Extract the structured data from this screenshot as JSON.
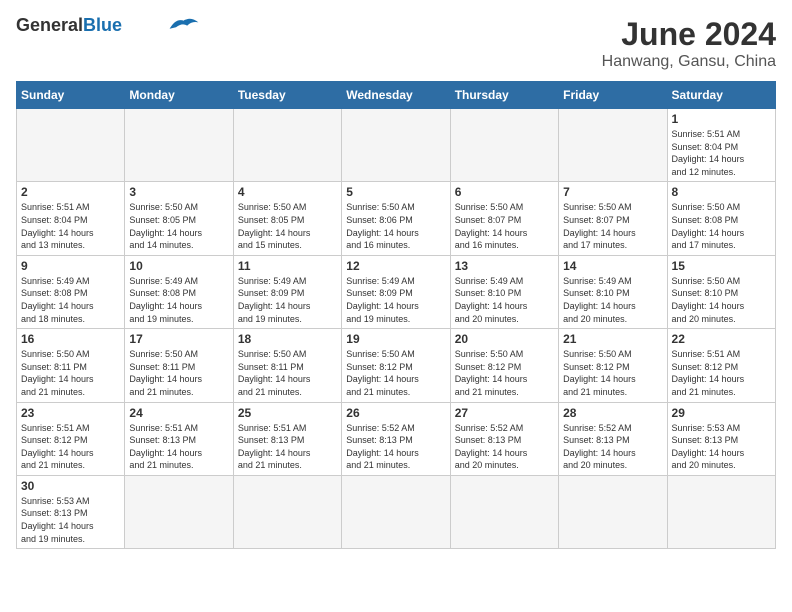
{
  "header": {
    "logo_line1": "General",
    "logo_line2": "Blue",
    "month_title": "June 2024",
    "location": "Hanwang, Gansu, China"
  },
  "weekdays": [
    "Sunday",
    "Monday",
    "Tuesday",
    "Wednesday",
    "Thursday",
    "Friday",
    "Saturday"
  ],
  "weeks": [
    [
      {
        "day": "",
        "info": ""
      },
      {
        "day": "",
        "info": ""
      },
      {
        "day": "",
        "info": ""
      },
      {
        "day": "",
        "info": ""
      },
      {
        "day": "",
        "info": ""
      },
      {
        "day": "",
        "info": ""
      },
      {
        "day": "1",
        "info": "Sunrise: 5:51 AM\nSunset: 8:04 PM\nDaylight: 14 hours\nand 12 minutes."
      }
    ],
    [
      {
        "day": "2",
        "info": "Sunrise: 5:51 AM\nSunset: 8:04 PM\nDaylight: 14 hours\nand 13 minutes."
      },
      {
        "day": "3",
        "info": "Sunrise: 5:50 AM\nSunset: 8:05 PM\nDaylight: 14 hours\nand 14 minutes."
      },
      {
        "day": "4",
        "info": "Sunrise: 5:50 AM\nSunset: 8:05 PM\nDaylight: 14 hours\nand 15 minutes."
      },
      {
        "day": "5",
        "info": "Sunrise: 5:50 AM\nSunset: 8:06 PM\nDaylight: 14 hours\nand 16 minutes."
      },
      {
        "day": "6",
        "info": "Sunrise: 5:50 AM\nSunset: 8:07 PM\nDaylight: 14 hours\nand 16 minutes."
      },
      {
        "day": "7",
        "info": "Sunrise: 5:50 AM\nSunset: 8:07 PM\nDaylight: 14 hours\nand 17 minutes."
      },
      {
        "day": "8",
        "info": "Sunrise: 5:50 AM\nSunset: 8:08 PM\nDaylight: 14 hours\nand 17 minutes."
      }
    ],
    [
      {
        "day": "9",
        "info": "Sunrise: 5:49 AM\nSunset: 8:08 PM\nDaylight: 14 hours\nand 18 minutes."
      },
      {
        "day": "10",
        "info": "Sunrise: 5:49 AM\nSunset: 8:08 PM\nDaylight: 14 hours\nand 19 minutes."
      },
      {
        "day": "11",
        "info": "Sunrise: 5:49 AM\nSunset: 8:09 PM\nDaylight: 14 hours\nand 19 minutes."
      },
      {
        "day": "12",
        "info": "Sunrise: 5:49 AM\nSunset: 8:09 PM\nDaylight: 14 hours\nand 19 minutes."
      },
      {
        "day": "13",
        "info": "Sunrise: 5:49 AM\nSunset: 8:10 PM\nDaylight: 14 hours\nand 20 minutes."
      },
      {
        "day": "14",
        "info": "Sunrise: 5:49 AM\nSunset: 8:10 PM\nDaylight: 14 hours\nand 20 minutes."
      },
      {
        "day": "15",
        "info": "Sunrise: 5:50 AM\nSunset: 8:10 PM\nDaylight: 14 hours\nand 20 minutes."
      }
    ],
    [
      {
        "day": "16",
        "info": "Sunrise: 5:50 AM\nSunset: 8:11 PM\nDaylight: 14 hours\nand 21 minutes."
      },
      {
        "day": "17",
        "info": "Sunrise: 5:50 AM\nSunset: 8:11 PM\nDaylight: 14 hours\nand 21 minutes."
      },
      {
        "day": "18",
        "info": "Sunrise: 5:50 AM\nSunset: 8:11 PM\nDaylight: 14 hours\nand 21 minutes."
      },
      {
        "day": "19",
        "info": "Sunrise: 5:50 AM\nSunset: 8:12 PM\nDaylight: 14 hours\nand 21 minutes."
      },
      {
        "day": "20",
        "info": "Sunrise: 5:50 AM\nSunset: 8:12 PM\nDaylight: 14 hours\nand 21 minutes."
      },
      {
        "day": "21",
        "info": "Sunrise: 5:50 AM\nSunset: 8:12 PM\nDaylight: 14 hours\nand 21 minutes."
      },
      {
        "day": "22",
        "info": "Sunrise: 5:51 AM\nSunset: 8:12 PM\nDaylight: 14 hours\nand 21 minutes."
      }
    ],
    [
      {
        "day": "23",
        "info": "Sunrise: 5:51 AM\nSunset: 8:12 PM\nDaylight: 14 hours\nand 21 minutes."
      },
      {
        "day": "24",
        "info": "Sunrise: 5:51 AM\nSunset: 8:13 PM\nDaylight: 14 hours\nand 21 minutes."
      },
      {
        "day": "25",
        "info": "Sunrise: 5:51 AM\nSunset: 8:13 PM\nDaylight: 14 hours\nand 21 minutes."
      },
      {
        "day": "26",
        "info": "Sunrise: 5:52 AM\nSunset: 8:13 PM\nDaylight: 14 hours\nand 21 minutes."
      },
      {
        "day": "27",
        "info": "Sunrise: 5:52 AM\nSunset: 8:13 PM\nDaylight: 14 hours\nand 20 minutes."
      },
      {
        "day": "28",
        "info": "Sunrise: 5:52 AM\nSunset: 8:13 PM\nDaylight: 14 hours\nand 20 minutes."
      },
      {
        "day": "29",
        "info": "Sunrise: 5:53 AM\nSunset: 8:13 PM\nDaylight: 14 hours\nand 20 minutes."
      }
    ],
    [
      {
        "day": "30",
        "info": "Sunrise: 5:53 AM\nSunset: 8:13 PM\nDaylight: 14 hours\nand 19 minutes."
      },
      {
        "day": "",
        "info": ""
      },
      {
        "day": "",
        "info": ""
      },
      {
        "day": "",
        "info": ""
      },
      {
        "day": "",
        "info": ""
      },
      {
        "day": "",
        "info": ""
      },
      {
        "day": "",
        "info": ""
      }
    ]
  ]
}
